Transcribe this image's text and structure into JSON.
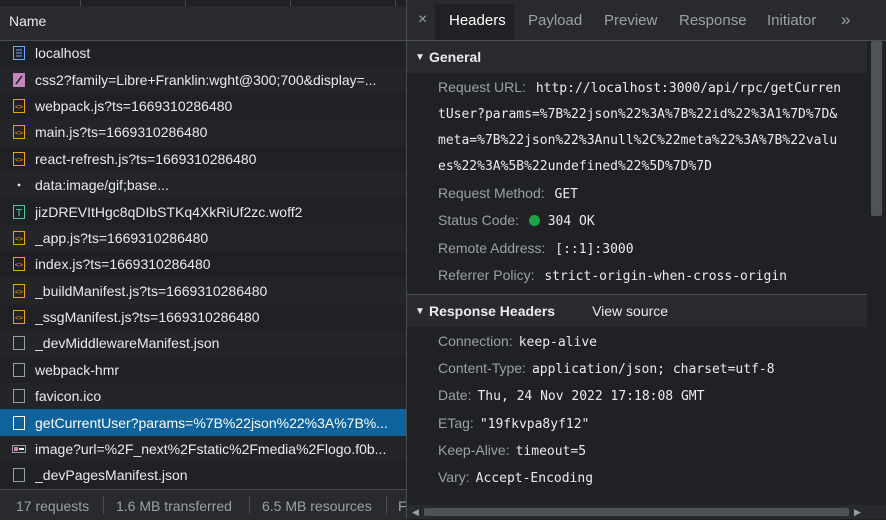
{
  "network": {
    "name_header": "Name",
    "requests": [
      {
        "name": "localhost",
        "icon": "document-icon",
        "color": "#6ea8fe"
      },
      {
        "name": "css2?family=Libre+Franklin:wght@300;700&display=...",
        "icon": "stylesheet-icon",
        "color": "#c586c0"
      },
      {
        "name": "webpack.js?ts=1669310286480",
        "icon": "script-icon",
        "color": "#f0a30a"
      },
      {
        "name": "main.js?ts=1669310286480",
        "icon": "script-icon",
        "color": "#f0a30a"
      },
      {
        "name": "react-refresh.js?ts=1669310286480",
        "icon": "script-icon",
        "color": "#f0a30a"
      },
      {
        "name": "data:image/gif;base...",
        "icon": "dot-image-icon",
        "color": "#e8eaed"
      },
      {
        "name": "jizDREVItHgc8qDIbSTKq4XkRiUf2zc.woff2",
        "icon": "font-icon",
        "color": "#4ec9b0"
      },
      {
        "name": "_app.js?ts=1669310286480",
        "icon": "script-icon",
        "color": "#f0a30a"
      },
      {
        "name": "index.js?ts=1669310286480",
        "icon": "script-icon",
        "color": "#f0a30a"
      },
      {
        "name": "_buildManifest.js?ts=1669310286480",
        "icon": "script-icon",
        "color": "#f0a30a"
      },
      {
        "name": "_ssgManifest.js?ts=1669310286480",
        "icon": "script-icon",
        "color": "#f0a30a"
      },
      {
        "name": "_devMiddlewareManifest.json",
        "icon": "blank-file-icon",
        "color": "#9aa0a6"
      },
      {
        "name": "webpack-hmr",
        "icon": "blank-file-icon",
        "color": "#9aa0a6"
      },
      {
        "name": "favicon.ico",
        "icon": "blank-file-icon",
        "color": "#9aa0a6"
      },
      {
        "name": "getCurrentUser?params=%7B%22json%22%3A%7B%...",
        "icon": "blank-file-icon",
        "color": "#ffffff",
        "selected": true
      },
      {
        "name": "image?url=%2F_next%2Fstatic%2Fmedia%2Flogo.f0b...",
        "icon": "image-icon",
        "color": "#9aa0a6"
      },
      {
        "name": "_devPagesManifest.json",
        "icon": "blank-file-icon",
        "color": "#9aa0a6"
      }
    ],
    "footer": {
      "requests": "17 requests",
      "transferred": "1.6 MB transferred",
      "resources": "6.5 MB resources",
      "more": "F"
    }
  },
  "details": {
    "close_label": "×",
    "tabs": [
      "Headers",
      "Payload",
      "Preview",
      "Response",
      "Initiator"
    ],
    "active_tab": "Headers",
    "more_tabs": "»",
    "general": {
      "title": "General",
      "request_url_key": "Request URL:",
      "request_url_lines": [
        "http://localhost:3000/api/rpc/getCurren",
        "tUser?params=%7B%22json%22%3A%7B%22id%22%3A1%7D%7D&",
        "meta=%7B%22json%22%3Anull%2C%22meta%22%3A%7B%22valu",
        "es%22%3A%5B%22undefined%22%5D%7D%7D"
      ],
      "request_method_key": "Request Method:",
      "request_method": "GET",
      "status_code_key": "Status Code:",
      "status_code": "304 OK",
      "status_color": "#1ea446",
      "remote_address_key": "Remote Address:",
      "remote_address": "[::1]:3000",
      "referrer_policy_key": "Referrer Policy:",
      "referrer_policy": "strict-origin-when-cross-origin"
    },
    "response_headers": {
      "title": "Response Headers",
      "view_source": "View source",
      "items": [
        {
          "key": "Connection:",
          "value": "keep-alive"
        },
        {
          "key": "Content-Type:",
          "value": "application/json; charset=utf-8"
        },
        {
          "key": "Date:",
          "value": "Thu, 24 Nov 2022 17:18:08 GMT"
        },
        {
          "key": "ETag:",
          "value": "\"19fkvpa8yf12\""
        },
        {
          "key": "Keep-Alive:",
          "value": "timeout=5"
        },
        {
          "key": "Vary:",
          "value": "Accept-Encoding"
        }
      ]
    }
  },
  "colors": {
    "selected_row": "#0e639c",
    "background": "#202124",
    "toolbar": "#292a2d"
  }
}
